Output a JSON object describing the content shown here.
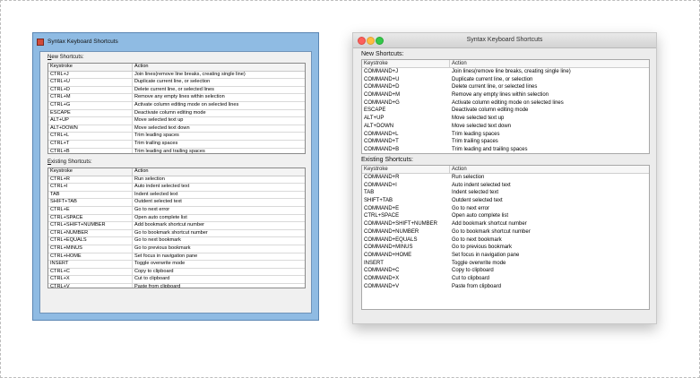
{
  "dialog": {
    "title": "Syntax Keyboard Shortcuts",
    "new_label": "New Shortcuts:",
    "new_label_windows_mnemonic": "N",
    "new_label_windows_rest": "ew Shortcuts:",
    "existing_label": "Existing Shortcuts:",
    "existing_label_windows_mnemonic": "E",
    "existing_label_windows_rest": "xisting Shortcuts:",
    "col_keystroke": "Keystroke",
    "col_action": "Action"
  },
  "windows": {
    "new_shortcuts": [
      {
        "key": "CTRL+J",
        "action": "Join lines(remove line breaks, creating single line)"
      },
      {
        "key": "CTRL+U",
        "action": "Duplicate current line, or selection"
      },
      {
        "key": "CTRL+D",
        "action": "Delete current line, or selected lines"
      },
      {
        "key": "CTRL+M",
        "action": "Remove any empty lines within selection"
      },
      {
        "key": "CTRL+G",
        "action": "Activate column editing mode on selected lines"
      },
      {
        "key": "ESCAPE",
        "action": "Deactivate column editing mode"
      },
      {
        "key": "ALT+UP",
        "action": "Move selected text up"
      },
      {
        "key": "ALT+DOWN",
        "action": "Move selected text down"
      },
      {
        "key": "CTRL+L",
        "action": "Trim leading spaces"
      },
      {
        "key": "CTRL+T",
        "action": "Trim trailing spaces"
      },
      {
        "key": "CTRL+B",
        "action": "Trim leading and trailing spaces"
      }
    ],
    "existing_shortcuts": [
      {
        "key": "CTRL+R",
        "action": "Run selection"
      },
      {
        "key": "CTRL+I",
        "action": "Auto indent selected text"
      },
      {
        "key": "TAB",
        "action": "Indent selected text"
      },
      {
        "key": "SHIFT+TAB",
        "action": "Outdent selected text"
      },
      {
        "key": "CTRL+E",
        "action": "Go to next error"
      },
      {
        "key": "CTRL+SPACE",
        "action": "Open auto complete list"
      },
      {
        "key": "CTRL+SHIFT+NUMBER",
        "action": "Add bookmark shortcut number"
      },
      {
        "key": "CTRL+NUMBER",
        "action": "Go to bookmark shortcut number"
      },
      {
        "key": "CTRL+EQUALS",
        "action": "Go to next bookmark"
      },
      {
        "key": "CTRL+MINUS",
        "action": "Go to previous bookmark"
      },
      {
        "key": "CTRL+HOME",
        "action": "Set focus in navigation pane"
      },
      {
        "key": "INSERT",
        "action": "Toggle overwrite mode"
      },
      {
        "key": "CTRL+C",
        "action": "Copy to clipboard"
      },
      {
        "key": "CTRL+X",
        "action": "Cut to clipboard"
      },
      {
        "key": "CTRL+V",
        "action": "Paste from clipboard"
      }
    ]
  },
  "mac": {
    "new_shortcuts": [
      {
        "key": "COMMAND+J",
        "action": "Join lines(remove line breaks, creating single line)"
      },
      {
        "key": "COMMAND+U",
        "action": "Duplicate current line, or selection"
      },
      {
        "key": "COMMAND+D",
        "action": "Delete current line, or selected lines"
      },
      {
        "key": "COMMAND+M",
        "action": "Remove any empty lines within selection"
      },
      {
        "key": "COMMAND+G",
        "action": "Activate column editing mode on selected lines"
      },
      {
        "key": "ESCAPE",
        "action": "Deactivate column editing mode"
      },
      {
        "key": "ALT+UP",
        "action": "Move selected text up"
      },
      {
        "key": "ALT+DOWN",
        "action": "Move selected text down"
      },
      {
        "key": "COMMAND+L",
        "action": "Trim leading spaces"
      },
      {
        "key": "COMMAND+T",
        "action": "Trim trailing spaces"
      },
      {
        "key": "COMMAND+B",
        "action": "Trim leading and trailing spaces"
      }
    ],
    "existing_shortcuts": [
      {
        "key": "COMMAND+R",
        "action": "Run selection"
      },
      {
        "key": "COMMAND+I",
        "action": "Auto indent selected text"
      },
      {
        "key": "TAB",
        "action": "Indent selected text"
      },
      {
        "key": "SHIFT+TAB",
        "action": "Outdent selected text"
      },
      {
        "key": "COMMAND+E",
        "action": "Go to next error"
      },
      {
        "key": "CTRL+SPACE",
        "action": "Open auto complete list"
      },
      {
        "key": "COMMAND+SHIFT+NUMBER",
        "action": "Add bookmark shortcut number"
      },
      {
        "key": "COMMAND+NUMBER",
        "action": "Go to bookmark shortcut number"
      },
      {
        "key": "COMMAND+EQUALS",
        "action": "Go to next bookmark"
      },
      {
        "key": "COMMAND+MINUS",
        "action": "Go to previous bookmark"
      },
      {
        "key": "COMMAND+HOME",
        "action": "Set focus in navigation pane"
      },
      {
        "key": "INSERT",
        "action": "Toggle overwrite mode"
      },
      {
        "key": "COMMAND+C",
        "action": "Copy to clipboard"
      },
      {
        "key": "COMMAND+X",
        "action": "Cut to clipboard"
      },
      {
        "key": "COMMAND+V",
        "action": "Paste from clipboard"
      }
    ]
  },
  "colors": {
    "windows_frame": "#8fbbe3",
    "mac_close": "#fc605c",
    "mac_minimize": "#fdbc40",
    "mac_zoom": "#34c84a"
  }
}
